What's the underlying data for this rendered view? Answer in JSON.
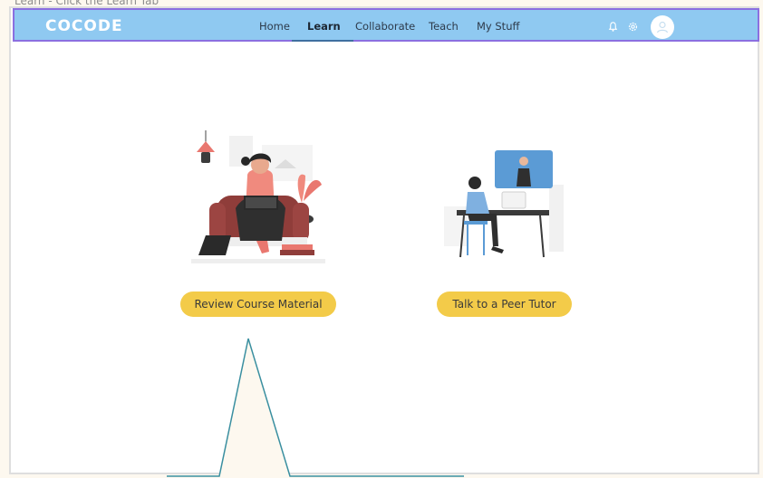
{
  "caption": "Learn - Click the Learn Tab",
  "brand": {
    "logo": "COCODE"
  },
  "nav": {
    "home": "Home",
    "learn": "Learn",
    "collaborate": "Collaborate",
    "teach": "Teach",
    "my_stuff": "My Stuff"
  },
  "header_icons": [
    "bell-icon",
    "gear-icon",
    "user-icon"
  ],
  "actions": {
    "review": "Review Course Material",
    "tutor": "Talk to a Peer Tutor"
  },
  "colors": {
    "navbar": "#8fc9f1",
    "navbar_border": "#8b6fe0",
    "button": "#f3cb49",
    "illustration_accent": "#e9776f",
    "illustration_blue": "#5b9bd5",
    "pointer_stroke": "#3a8fa0",
    "pointer_fill": "#fdf8ef"
  }
}
